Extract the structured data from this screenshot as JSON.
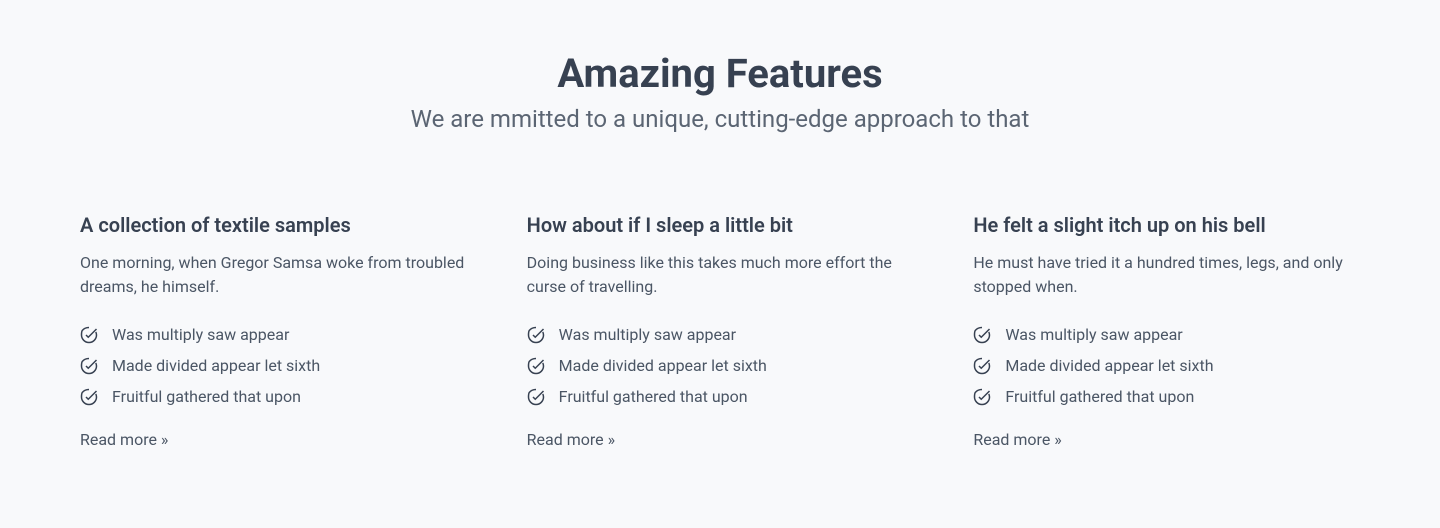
{
  "header": {
    "title": "Amazing Features",
    "subtitle": "We are mmitted to a unique, cutting-edge approach to that"
  },
  "features": [
    {
      "title": "A collection of textile samples",
      "description": "One morning, when Gregor Samsa woke from troubled dreams, he himself.",
      "bullets": [
        "Was multiply saw appear",
        "Made divided appear let sixth",
        "Fruitful gathered that upon"
      ],
      "read_more": "Read more »"
    },
    {
      "title": "How about if I sleep a little bit",
      "description": "Doing business like this takes much more effort the curse of travelling.",
      "bullets": [
        "Was multiply saw appear",
        "Made divided appear let sixth",
        "Fruitful gathered that upon"
      ],
      "read_more": "Read more »"
    },
    {
      "title": "He felt a slight itch up on his bell",
      "description": "He must have tried it a hundred times, legs, and only stopped when.",
      "bullets": [
        "Was multiply saw appear",
        "Made divided appear let sixth",
        "Fruitful gathered that upon"
      ],
      "read_more": "Read more »"
    }
  ]
}
